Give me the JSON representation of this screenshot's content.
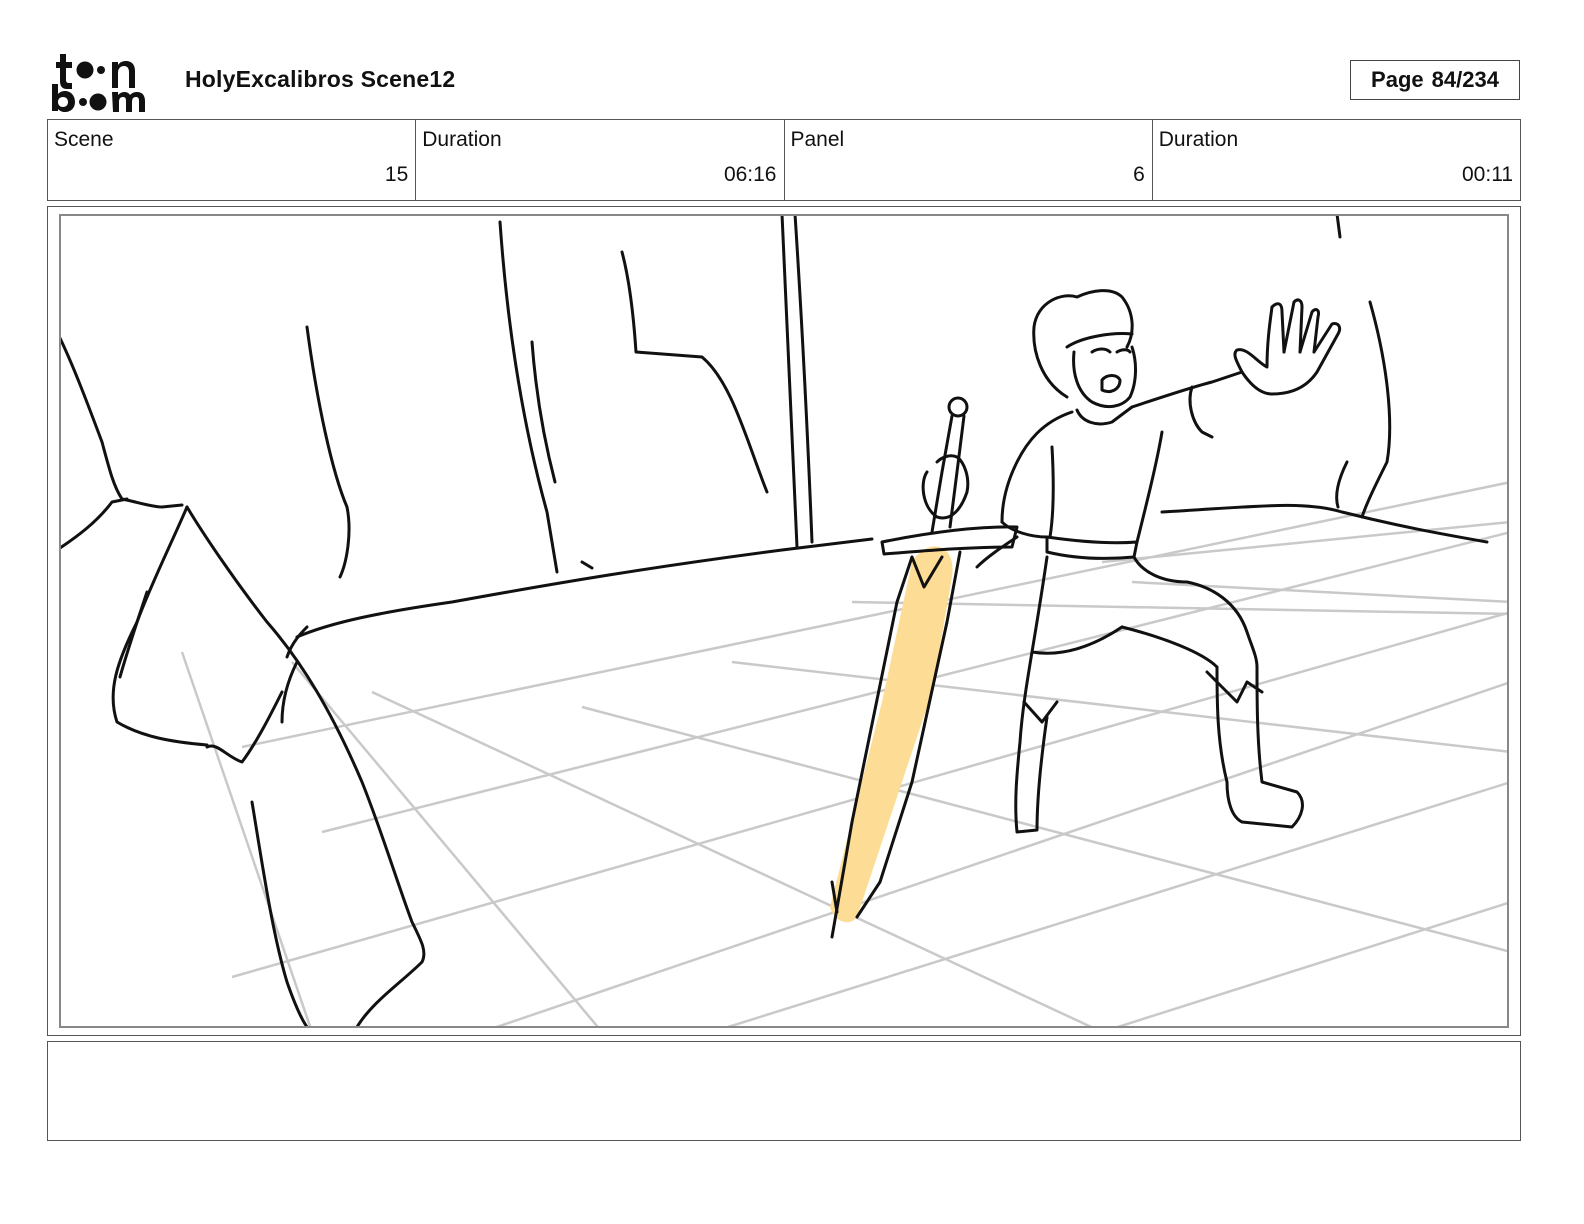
{
  "header": {
    "logo_text_top": "toon",
    "logo_text_bottom": "boom",
    "title": "HolyExcalibros Scene12",
    "page_label": "Page",
    "page_value": "84/234"
  },
  "info": {
    "scene_label": "Scene",
    "scene_value": "15",
    "scene_duration_label": "Duration",
    "scene_duration_value": "06:16",
    "panel_label": "Panel",
    "panel_value": "6",
    "panel_duration_label": "Duration",
    "panel_duration_value": "00:11"
  },
  "panel": {
    "sword_highlight_color": "#FDDC95",
    "floor_grid_color": "#C9C9C9",
    "line_color": "#111111"
  },
  "notes": {
    "text": ""
  }
}
